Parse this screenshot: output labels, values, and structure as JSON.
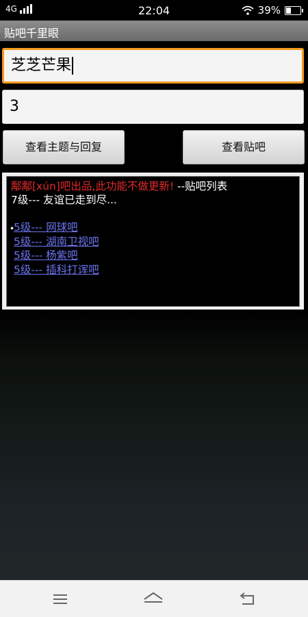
{
  "status": {
    "network": "4G",
    "time": "22:04",
    "battery_pct": "39%",
    "battery_level": 0.39
  },
  "app": {
    "title": "贴吧千里眼"
  },
  "form": {
    "name_input_value": "芝芝芒果",
    "count_input_value": "3",
    "btn_threads": "查看主题与回复",
    "btn_bars": "查看贴吧"
  },
  "result": {
    "notice_red": "鄅鄅[xún]吧出品,此功能不做更新!",
    "notice_suffix": " --贴吧列表",
    "summary": "7级--- 友谊已走到尽...",
    "links": [
      "5级--- 网球吧",
      "5级--- 湖南卫视吧",
      "5级--- 杨紫吧",
      "5级--- 插科打诨吧"
    ]
  },
  "navbar": {
    "icons": [
      "menu-icon",
      "home-icon",
      "back-icon"
    ]
  },
  "colors": {
    "accent": "#f49a1e",
    "link": "#6b74f0",
    "notice": "#e22a2a"
  }
}
